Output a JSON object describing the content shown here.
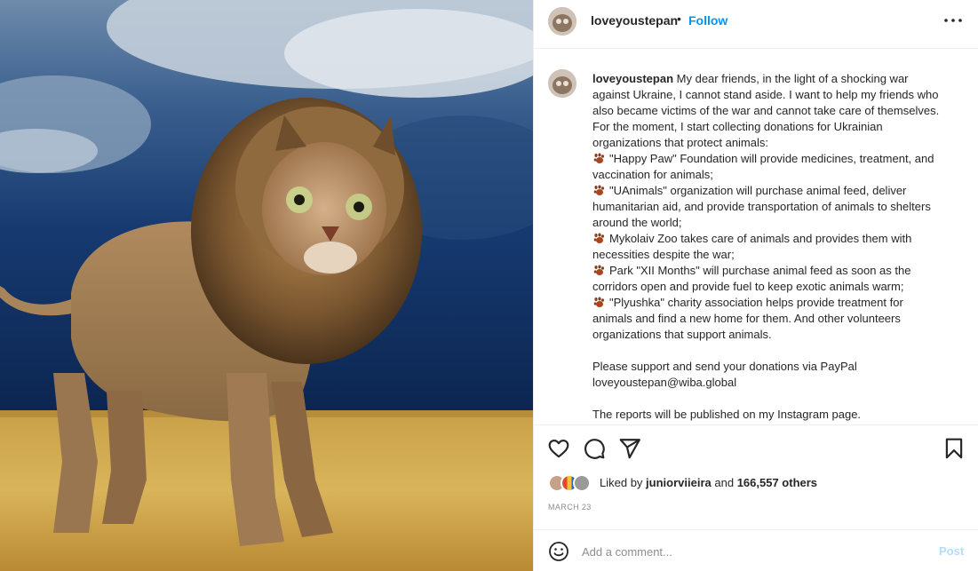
{
  "post": {
    "username": "loveyoustepan",
    "separator": "•",
    "follow_label": "Follow",
    "more_icon": "more-horizontal-icon"
  },
  "caption": {
    "username": "loveyoustepan",
    "lines": [
      {
        "text": "My dear friends, in the light of a shocking war",
        "lead": true
      },
      {
        "text": "against Ukraine, I cannot stand aside. I want to help my friends who"
      },
      {
        "text": "also became victims of the war and cannot take care of themselves."
      },
      {
        "text": "For the moment, I start collecting donations for Ukrainian"
      },
      {
        "text": "organizations that protect animals:"
      },
      {
        "text": "\"Happy Paw\" Foundation will provide medicines, treatment, and",
        "paw": true
      },
      {
        "text": "vaccination for animals;"
      },
      {
        "text": "\"UAnimals\" organization will purchase animal feed, deliver",
        "paw": true
      },
      {
        "text": "humanitarian aid, and provide transportation of animals to shelters"
      },
      {
        "text": "around the world;"
      },
      {
        "text": "Mykolaiv Zoo takes care of animals and provides them with",
        "paw": true
      },
      {
        "text": "necessities despite the war;"
      },
      {
        "text": "Park \"XII Months\" will purchase animal feed as soon as the",
        "paw": true
      },
      {
        "text": "corridors open and provide fuel to keep exotic animals warm;"
      },
      {
        "text": "\"Plyushka\" charity association helps provide treatment for",
        "paw": true
      },
      {
        "text": "animals and find a new home for them. And other volunteers"
      },
      {
        "text": "organizations that support animals."
      },
      {
        "text": ""
      },
      {
        "text": "Please support and send your donations via PayPal"
      },
      {
        "text": "loveyoustepan@wiba.global"
      },
      {
        "text": ""
      },
      {
        "text": "The reports will be published on my Instagram page."
      }
    ],
    "paw_icon": "paw-prints-emoji-icon"
  },
  "actions": {
    "like_icon": "heart-icon",
    "comment_icon": "comment-icon",
    "share_icon": "share-paper-plane-icon",
    "save_icon": "bookmark-icon"
  },
  "likes": {
    "prefix": "Liked by",
    "user": "juniorviieira",
    "middle": "and",
    "count": "166,557 others"
  },
  "date": "MARCH 23",
  "comment": {
    "placeholder": "Add a comment...",
    "post_label": "Post",
    "emoji_icon": "smiley-face-icon"
  },
  "colors": {
    "accent": "#0095f6",
    "post_disabled": "#b3dbff",
    "muted": "#8e8e8e",
    "text": "#262626",
    "border": "#efefef"
  }
}
